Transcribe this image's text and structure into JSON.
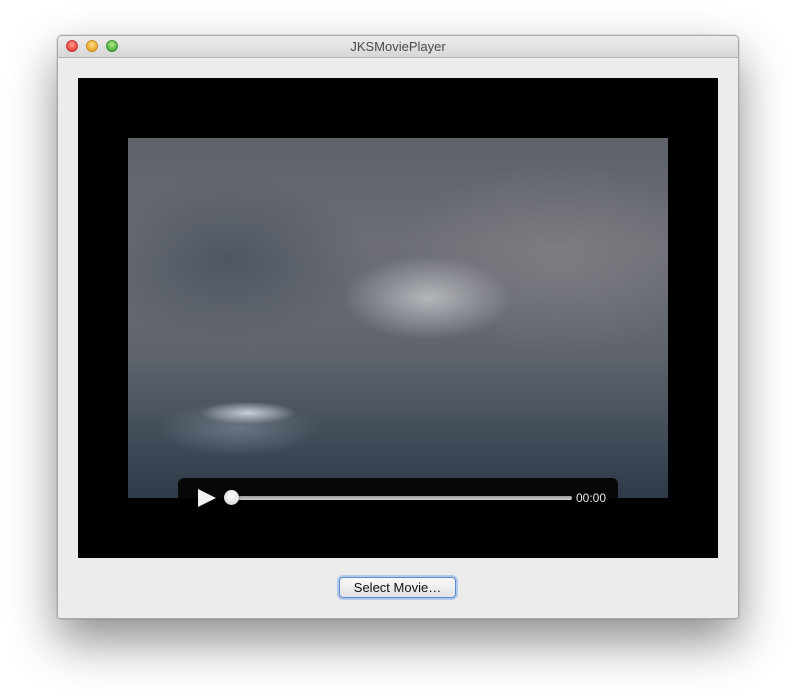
{
  "window": {
    "title": "JKSMoviePlayer"
  },
  "player": {
    "time": "00:00",
    "progress": 0,
    "state": "paused",
    "frame_description_icon": "cloudy-sky-frame"
  },
  "actions": {
    "select_movie_label": "Select Movie…"
  },
  "colors": {
    "video_background": "#000000",
    "window_background": "#ececec",
    "button_focus": "#5b8ad8"
  }
}
